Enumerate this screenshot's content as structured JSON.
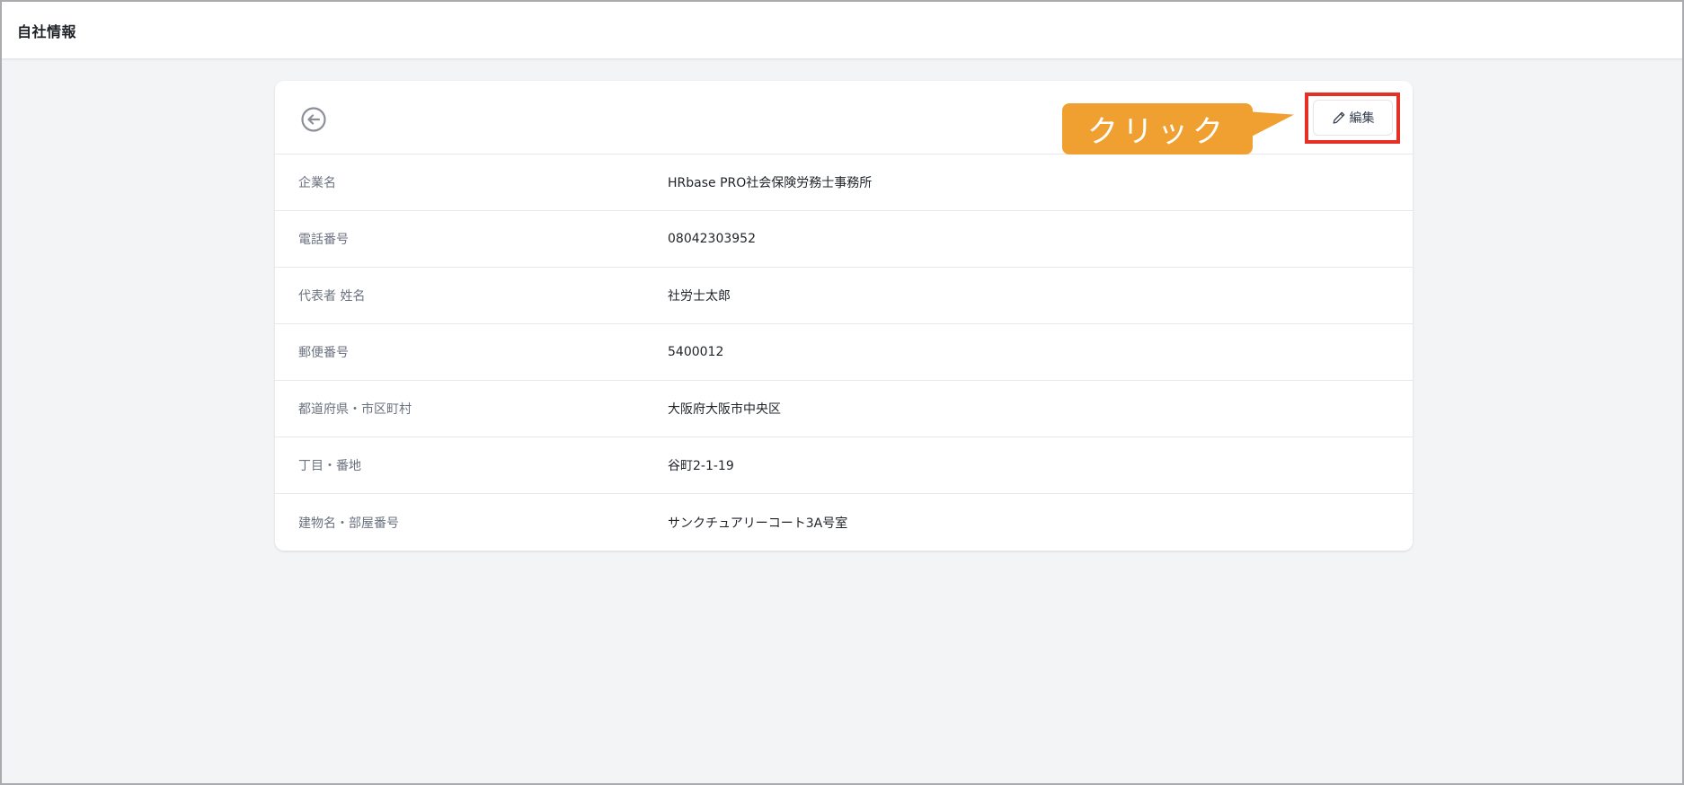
{
  "page": {
    "title": "自社情報"
  },
  "toolbar": {
    "back_icon": "arrow-left-circle-icon",
    "edit_icon": "pencil-icon",
    "edit_label": "編集"
  },
  "callout": {
    "text": "クリック",
    "color": "#f0a030"
  },
  "highlight": {
    "color": "#e53125"
  },
  "fields": [
    {
      "label": "企業名",
      "value": "HRbase PRO社会保険労務士事務所"
    },
    {
      "label": "電話番号",
      "value": "08042303952"
    },
    {
      "label": "代表者 姓名",
      "value": "社労士太郎"
    },
    {
      "label": "郵便番号",
      "value": "5400012"
    },
    {
      "label": "都道府県・市区町村",
      "value": "大阪府大阪市中央区"
    },
    {
      "label": "丁目・番地",
      "value": "谷町2-1-19"
    },
    {
      "label": "建物名・部屋番号",
      "value": "サンクチュアリーコート3A号室"
    }
  ]
}
